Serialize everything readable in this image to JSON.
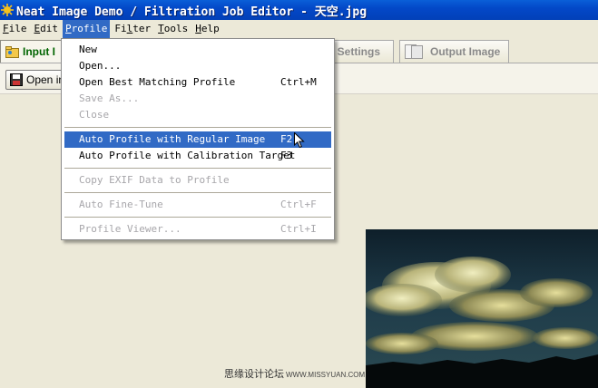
{
  "window": {
    "title": "Neat Image Demo / Filtration Job Editor - 天空.jpg",
    "icon": "neat-image-app-icon"
  },
  "menubar": {
    "items": [
      "File",
      "Edit",
      "Profile",
      "Filter",
      "Tools",
      "Help"
    ],
    "active": "Profile"
  },
  "tabs": {
    "input": "Input I",
    "filter": "er Settings",
    "output": "Output Image"
  },
  "toolbar": {
    "open_label": "Open in"
  },
  "profile_menu": {
    "items": [
      {
        "label": "New",
        "shortcut": "",
        "enabled": true
      },
      {
        "label": "Open...",
        "shortcut": "",
        "enabled": true
      },
      {
        "label": "Open Best Matching Profile",
        "shortcut": "Ctrl+M",
        "enabled": true
      },
      {
        "label": "Save As...",
        "shortcut": "",
        "enabled": false
      },
      {
        "label": "Close",
        "shortcut": "",
        "enabled": false
      },
      {
        "label": "Auto Profile with Regular Image",
        "shortcut": "F2",
        "enabled": true,
        "highlighted": true
      },
      {
        "label": "Auto Profile with Calibration Target",
        "shortcut": "F3",
        "enabled": true
      },
      {
        "label": "Copy EXIF Data to Profile",
        "shortcut": "",
        "enabled": false
      },
      {
        "label": "Auto Fine-Tune",
        "shortcut": "Ctrl+F",
        "enabled": false
      },
      {
        "label": "Profile Viewer...",
        "shortcut": "Ctrl+I",
        "enabled": false
      }
    ]
  },
  "watermark": {
    "text": "思缘设计论坛",
    "site": "WWW.MISSYUAN.COM"
  },
  "colors": {
    "titlebar": "#0348c8",
    "menu_highlight": "#316ac5",
    "background": "#ece9d8",
    "input_tab_text": "#006400"
  }
}
